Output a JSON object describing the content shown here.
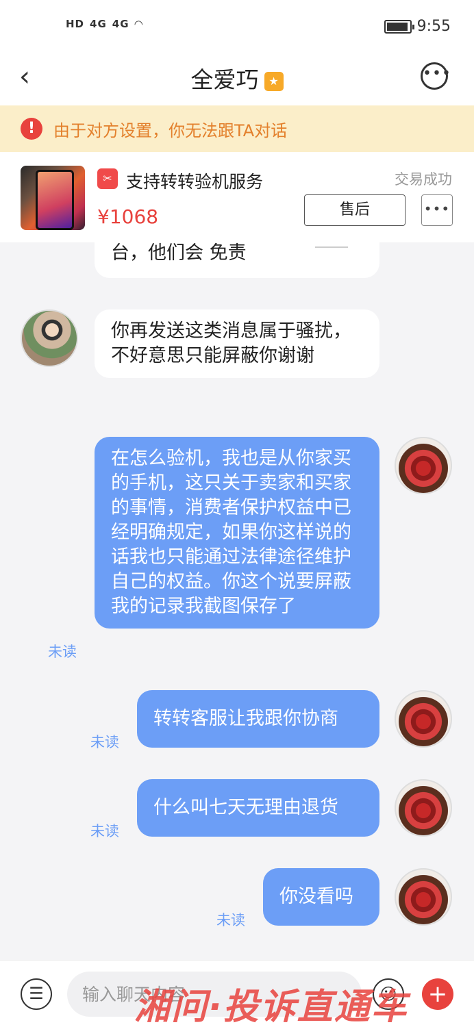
{
  "status_bar": {
    "network": [
      "HD",
      "4G",
      "4G"
    ],
    "time": "9:55"
  },
  "header": {
    "title": "全爱巧"
  },
  "notice": {
    "icon": "!",
    "text": "由于对方设置，你无法跟TA对话"
  },
  "product": {
    "service_title": "支持转转验机服务",
    "price": "¥1068",
    "status": "交易成功",
    "aftersale_label": "售后",
    "more_label": "•••"
  },
  "messages": [
    {
      "text": "台，他们会  免责",
      "sender": "other"
    },
    {
      "text": "你再发送这类消息属于骚扰，不好意思只能屏蔽你谢谢",
      "sender": "other"
    },
    {
      "text": "在怎么验机，我也是从你家买的手机，这只关于卖家和买家的事情，消费者保护权益中已经明确规定，如果你这样说的话我也只能通过法律途径维护自己的权益。你这个说要屏蔽我的记录我截图保存了",
      "sender": "me",
      "status": "未读"
    },
    {
      "text": "转转客服让我跟你协商",
      "sender": "me",
      "status": "未读"
    },
    {
      "text": "什么叫七天无理由退货",
      "sender": "me",
      "status": "未读"
    },
    {
      "text": "你没看吗",
      "sender": "me",
      "status": "未读"
    }
  ],
  "input": {
    "placeholder": "输入聊天内容"
  },
  "watermark": "湘问·投诉直通车"
}
